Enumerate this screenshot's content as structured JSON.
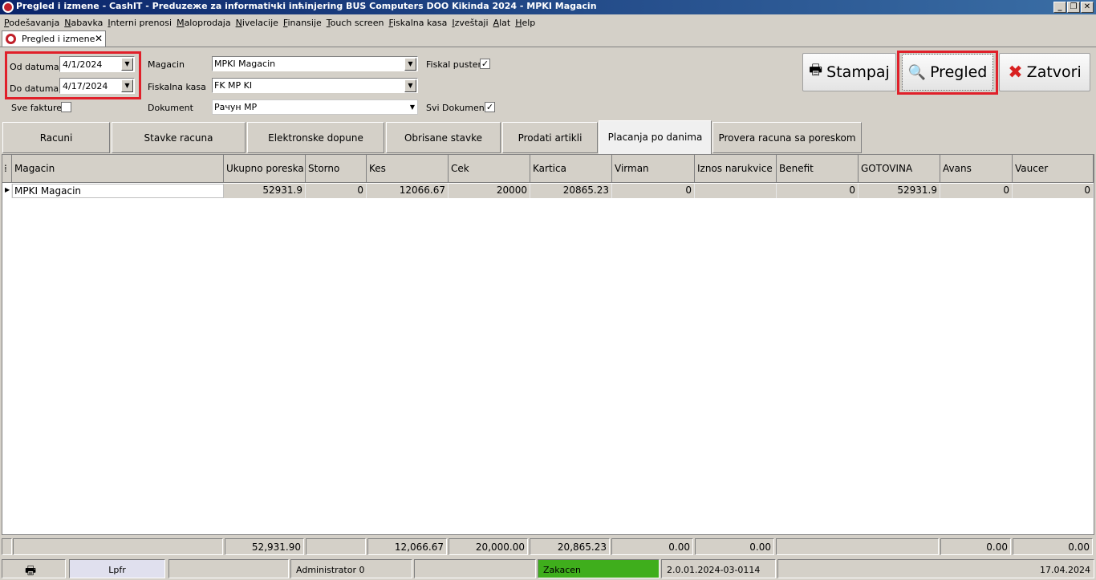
{
  "window": {
    "title": "Pregled i izmene - CashIT - Preduzeжe za informatiчki inћinjering BUS Computers DOO Kikinda 2024 - MPKI Magacin"
  },
  "menu": [
    "Podešavanja",
    "Nabavka",
    "Interni prenosi",
    "Maloprodaja",
    "Nivelacije",
    "Finansije",
    "Touch screen",
    "Fiskalna kasa",
    "Izveštaji",
    "Alat",
    "Help"
  ],
  "doc_tab": {
    "label": "Pregled i izmene"
  },
  "filters": {
    "od_datuma_label": "Od datuma",
    "od_datuma": "4/1/2024",
    "do_datuma_label": "Do datuma",
    "do_datuma": "4/17/2024",
    "sve_fakture_label": "Sve fakture",
    "magacin_label": "Magacin",
    "magacin": "MPKI Magacin",
    "fiskalna_kasa_label": "Fiskalna kasa",
    "fiskalna_kasa": "FK MP KI",
    "dokument_label": "Dokument",
    "dokument": "Рачун МР",
    "fiskal_pusten_label": "Fiskal pusten",
    "svi_dokumenti_label": "Svi Dokumenti"
  },
  "buttons": {
    "stampaj": "Stampaj",
    "pregled": "Pregled",
    "zatvori": "Zatvori"
  },
  "tabs": [
    "Racuni",
    "Stavke racuna",
    "Elektronske dopune",
    "Obrisane stavke",
    "Prodati artikli",
    "Placanja po danima",
    "Provera racuna sa poreskom"
  ],
  "grid": {
    "columns": [
      "Magacin",
      "Ukupno poreska",
      "Storno",
      "Kes",
      "Cek",
      "Kartica",
      "Virman",
      "Iznos narukvice",
      "Benefit",
      "GOTOVINA",
      "Avans",
      "Vaucer"
    ],
    "row": [
      "MPKI Magacin",
      "52931.9",
      "0",
      "12066.67",
      "20000",
      "20865.23",
      "0",
      "",
      "0",
      "52931.9",
      "0",
      "0"
    ],
    "totals": [
      "",
      "52,931.90",
      "",
      "12,066.67",
      "20,000.00",
      "20,865.23",
      "0.00",
      "0.00",
      "",
      "",
      "0.00",
      "0.00"
    ]
  },
  "status": {
    "lpfr": "Lpfr",
    "user": "Administrator 0",
    "state": "Zakacen",
    "version": "2.0.01.2024-03-0114",
    "date": "17.04.2024"
  },
  "colors": {
    "title_bar": "#0a246a",
    "highlight": "#e0202a",
    "status_green": "#3fae1c"
  }
}
